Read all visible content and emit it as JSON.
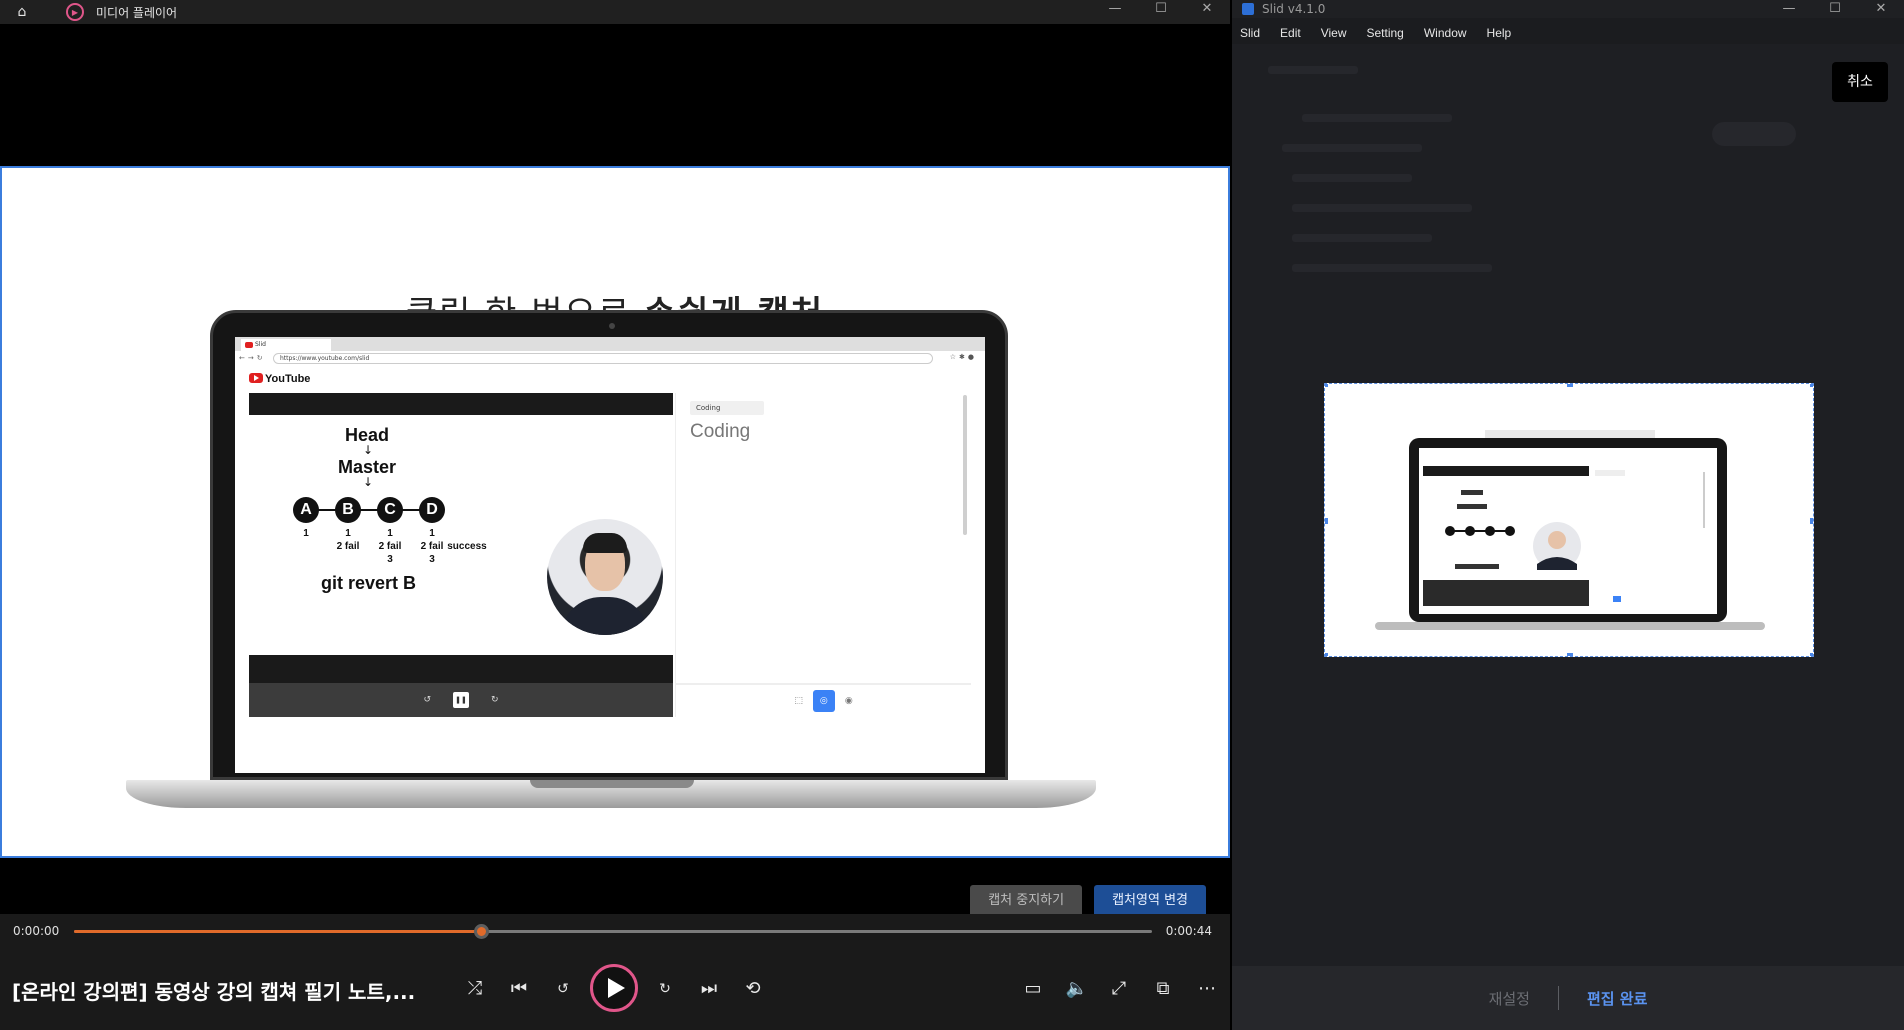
{
  "player": {
    "title": "미디어 플레이어",
    "window_controls": [
      "—",
      "☐",
      "✕"
    ],
    "slide_heading": "클릭 한 번으로 ",
    "slide_heading_bold": "손쉽게 캡처",
    "browser": {
      "tab_label": "Slid",
      "url": "https://www.youtube.com/slid",
      "site_logo": "YouTube"
    },
    "lecture": {
      "head_label": "Head",
      "master_label": "Master",
      "nodes": [
        "A",
        "B",
        "C",
        "D"
      ],
      "node_notes": [
        [
          "1"
        ],
        [
          "1",
          "2 fail"
        ],
        [
          "1",
          "2 fail",
          "3"
        ],
        [
          "1",
          "2 fail",
          "3"
        ]
      ],
      "success_label": "success",
      "command": "git revert B"
    },
    "note_panel": {
      "folder": "Coding",
      "title": "Coding"
    },
    "capture_buttons": {
      "stop": "캡처 중지하기",
      "change_area": "캡처영역 변경"
    },
    "transport": {
      "time_current": "0:00:00",
      "time_total": "0:00:44",
      "progress": 0.378,
      "media_title": "[온라인 강의편] 동영상 강의 캡쳐 필기 노트,..."
    }
  },
  "slid": {
    "title": "Slid v4.1.0",
    "menu": [
      "Slid",
      "Edit",
      "View",
      "Setting",
      "Window",
      "Help"
    ],
    "window_controls": [
      "—",
      "☐",
      "✕"
    ],
    "cancel_label": "취소",
    "reset_label": "재설정",
    "done_label": "편집 완료"
  },
  "colors": {
    "accent_orange": "#e06a2a",
    "accent_pink": "#e0568a",
    "capture_blue": "#3b7ddd",
    "done_blue": "#5a93f0"
  }
}
